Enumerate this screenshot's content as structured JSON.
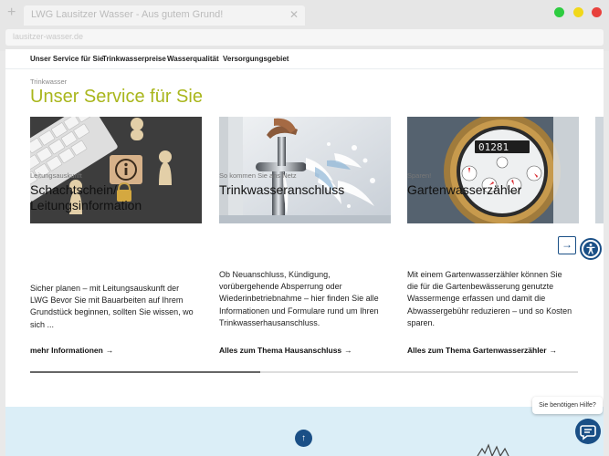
{
  "browser": {
    "tab_title": "LWG Lausitzer Wasser - Aus gutem Grund!",
    "url": "lausitzer-wasser.de",
    "accent_colors": {
      "green": "#2ecc40",
      "yellow": "#f1d81a",
      "red": "#e8413c"
    }
  },
  "nav": {
    "items": [
      {
        "label": "Unser Service für Sie"
      },
      {
        "label": "Trinkwasserpreise"
      },
      {
        "label": "Wasserqualität"
      },
      {
        "label": "Versorgungsgebiet"
      }
    ]
  },
  "section": {
    "kicker": "Trinkwasser",
    "title": "Unser Service für Sie",
    "title_color": "#a9b61c"
  },
  "cards": [
    {
      "category": "Leitungsauskunft",
      "title_lines": [
        "Schachtschein/",
        "Leitungsinformation"
      ],
      "text_lines": [
        "Sicher planen – mit Leitungsauskunft der",
        "LWG Bevor Sie mit Bauarbeiten auf Ihrem",
        "Grundstück beginnen, sollten Sie wissen, wo",
        "sich ..."
      ],
      "link": "mehr Informationen",
      "image_icon": "info-lock-image"
    },
    {
      "category": "So kommen Sie ans Netz",
      "title_lines": [
        "Trinkwasseranschluss"
      ],
      "text_lines": [
        "Ob Neuanschluss, Kündigung,",
        "vorübergehende Absperrung oder",
        "Wiederinbetriebnahme – hier finden Sie alle",
        "Informationen und Formulare rund um Ihren",
        "Trinkwasserhausanschluss."
      ],
      "link": "Alles zum Thema Hausanschluss",
      "image_icon": "water-tap-image"
    },
    {
      "category": "Sparen!",
      "title_lines": [
        "Gartenwasserzähler"
      ],
      "text_lines": [
        "Mit einem Gartenwasserzähler können Sie",
        "die für die Gartenbewässerung genutzte",
        "Wassermenge erfassen und damit die",
        "Abwassergebühr reduzieren – und so Kosten",
        "sparen."
      ],
      "link": "Alles zum Thema Gartenwasserzähler",
      "image_icon": "water-meter-image",
      "meter_reading": "01281"
    }
  ],
  "carousel": {
    "progress": 0.42,
    "next_icon": "arrow-right-icon"
  },
  "help": {
    "bubble_text": "Sie benötigen Hilfe?",
    "chat_icon": "chat-icon"
  },
  "back_to_top_icon": "arrow-up-icon",
  "accessibility_icon": "accessibility-icon",
  "brand_blue": "#1a4f86"
}
